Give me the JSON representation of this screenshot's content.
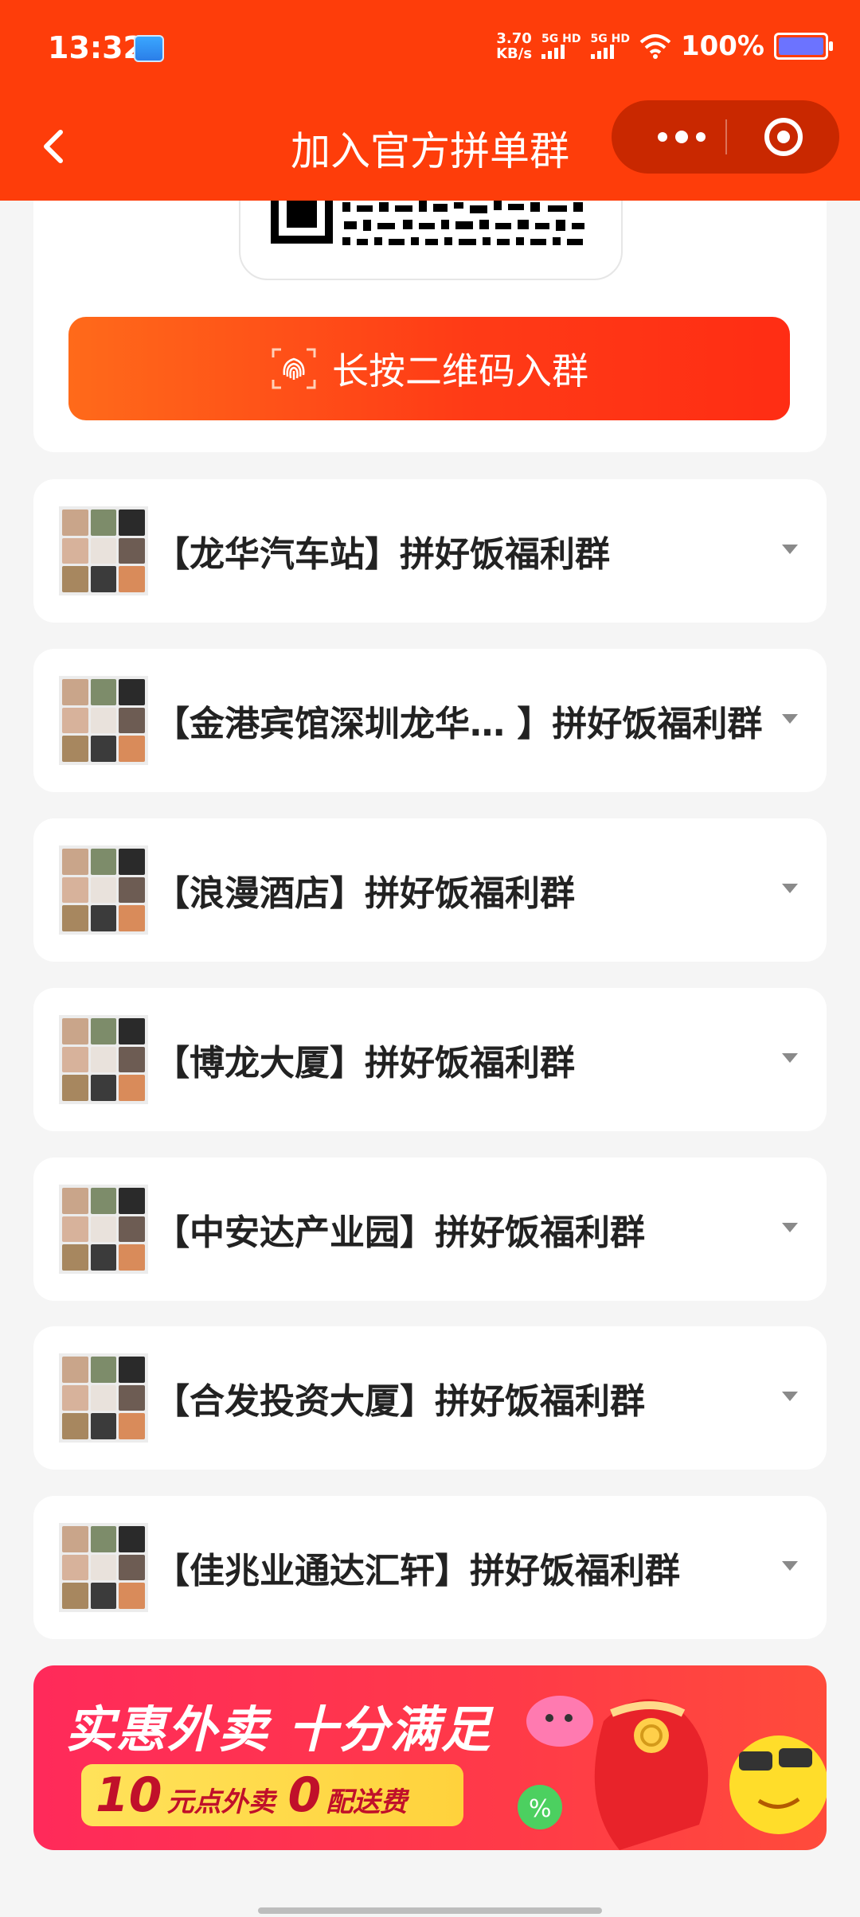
{
  "status_bar": {
    "time": "13:32",
    "net_speed_value": "3.70",
    "net_speed_unit": "KB/s",
    "sim1_label": "5G HD",
    "sim2_label": "5G HD",
    "battery": "100%"
  },
  "header": {
    "title": "加入官方拼单群",
    "back_icon": "chevron-left-icon",
    "more_icon": "more-dots-icon",
    "close_icon": "target-circle-icon"
  },
  "qr_section": {
    "join_button_label": "长按二维码入群",
    "join_button_icon": "fingerprint-icon"
  },
  "groups": [
    {
      "name": "【龙华汽车站】拼好饭福利群"
    },
    {
      "name": "【金港宾馆深圳龙华… 】拼好饭福利群"
    },
    {
      "name": "【浪漫酒店】拼好饭福利群"
    },
    {
      "name": "【博龙大厦】拼好饭福利群"
    },
    {
      "name": "【中安达产业园】拼好饭福利群"
    },
    {
      "name": "【合发投资大厦】拼好饭福利群"
    },
    {
      "name": "【佳兆业通达汇轩】拼好饭福利群"
    }
  ],
  "banner": {
    "title": "实惠外卖 十分满足",
    "amount_1": "10",
    "text_1": "元点外卖",
    "amount_2": "0",
    "text_2": "配送费"
  },
  "colors": {
    "header_bg": "#fe3d0a",
    "button_gradient_start": "#ff6a1a",
    "button_gradient_end": "#ff2d14",
    "banner_bg": "#ff2a5a",
    "page_bg": "#f5f5f5"
  }
}
